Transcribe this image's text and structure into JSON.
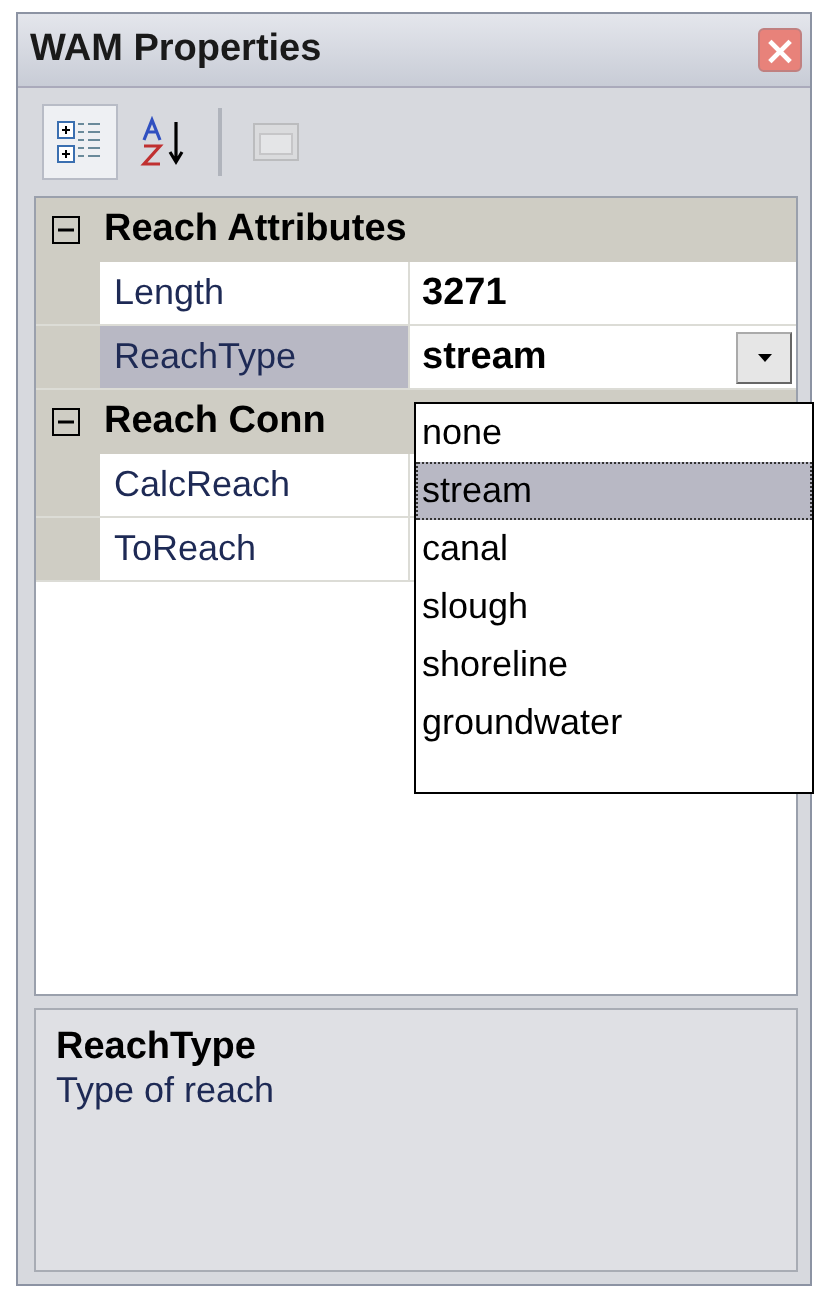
{
  "window": {
    "title": "WAM Properties",
    "close": "×"
  },
  "toolbar": [
    {
      "kind": "categorized",
      "selected": true,
      "disabled": false
    },
    {
      "kind": "alphabetical",
      "selected": false,
      "disabled": false
    },
    {
      "kind": "pages",
      "selected": false,
      "disabled": true
    }
  ],
  "categories": [
    {
      "name": "Reach Attributes",
      "expanded": true,
      "properties": [
        {
          "name": "Length",
          "value": "3271",
          "selected": false,
          "dropdown": false
        },
        {
          "name": "ReachType",
          "value": "stream",
          "selected": true,
          "dropdown": true
        }
      ]
    },
    {
      "name": "Reach Conn",
      "expanded": true,
      "properties": [
        {
          "name": "CalcReach",
          "selected": false
        },
        {
          "name": "ToReach",
          "selected": false
        }
      ]
    }
  ],
  "dropdown_list": [
    {
      "label": "none",
      "selected": false
    },
    {
      "label": "stream",
      "selected": true
    },
    {
      "label": "canal",
      "selected": false
    },
    {
      "label": "slough",
      "selected": false
    },
    {
      "label": "shoreline",
      "selected": false
    },
    {
      "label": "groundwater",
      "selected": false
    }
  ],
  "description": {
    "title": "ReachType",
    "text": "Type of reach"
  }
}
